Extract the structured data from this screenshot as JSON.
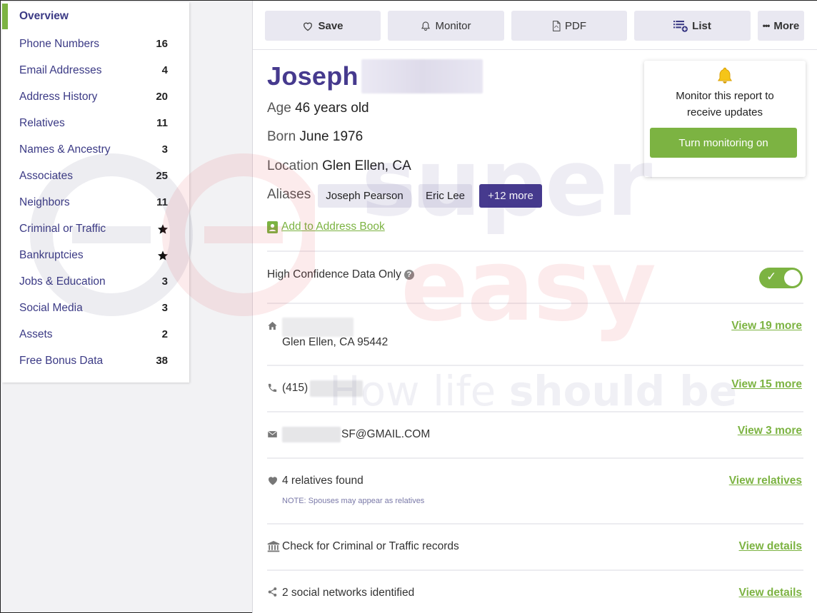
{
  "sidebar": {
    "items": [
      {
        "label": "Overview",
        "count": ""
      },
      {
        "label": "Phone Numbers",
        "count": "16"
      },
      {
        "label": "Email Addresses",
        "count": "4"
      },
      {
        "label": "Address History",
        "count": "20"
      },
      {
        "label": "Relatives",
        "count": "11"
      },
      {
        "label": "Names & Ancestry",
        "count": "3"
      },
      {
        "label": "Associates",
        "count": "25"
      },
      {
        "label": "Neighbors",
        "count": "11"
      },
      {
        "label": "Criminal or Traffic",
        "count": "star-icon"
      },
      {
        "label": "Bankruptcies",
        "count": "star-icon"
      },
      {
        "label": "Jobs & Education",
        "count": "3"
      },
      {
        "label": "Social Media",
        "count": "3"
      },
      {
        "label": "Assets",
        "count": "2"
      },
      {
        "label": "Free Bonus Data",
        "count": "38"
      }
    ]
  },
  "toolbar": {
    "save": "Save",
    "monitor": "Monitor",
    "pdf": "PDF",
    "list": "List",
    "more": "More"
  },
  "profile": {
    "first_name": "Joseph",
    "age_label": "Age",
    "age_value": "46 years old",
    "born_label": "Born",
    "born_value": "June 1976",
    "location_label": "Location",
    "location_value": "Glen Ellen, CA",
    "aliases_label": "Aliases",
    "aliases": [
      "Joseph Pearson",
      "Eric Lee",
      "+12 more"
    ],
    "add_address_book": "Add to Address Book"
  },
  "monitor_card": {
    "text_line1": "Monitor this report to",
    "text_line2": "receive updates",
    "button": "Turn monitoring on"
  },
  "confidence": {
    "label": "High Confidence Data Only",
    "help": "?",
    "check": "✓"
  },
  "rows": {
    "address_text": "Glen Ellen, CA 95442",
    "address_link": "View 19 more",
    "phone_text": "(415)",
    "phone_link": "View 15 more",
    "email_text": "SF@GMAIL.COM",
    "email_link": "View 3 more",
    "relatives_text": "4 relatives found",
    "relatives_note": "NOTE: Spouses may appear as relatives",
    "relatives_link": "View relatives",
    "criminal_text": "Check for Criminal or Traffic records",
    "criminal_link": "View details",
    "social_text": "2 social networks identified",
    "social_link": "View details"
  },
  "watermark": {
    "line1": "super",
    "line2": "easy",
    "line3_a": "How life ",
    "line3_b": "should be"
  },
  "colors": {
    "brand_purple": "#463a8e",
    "accent_green": "#7cb342",
    "chip_bg": "#e9e8f1"
  }
}
